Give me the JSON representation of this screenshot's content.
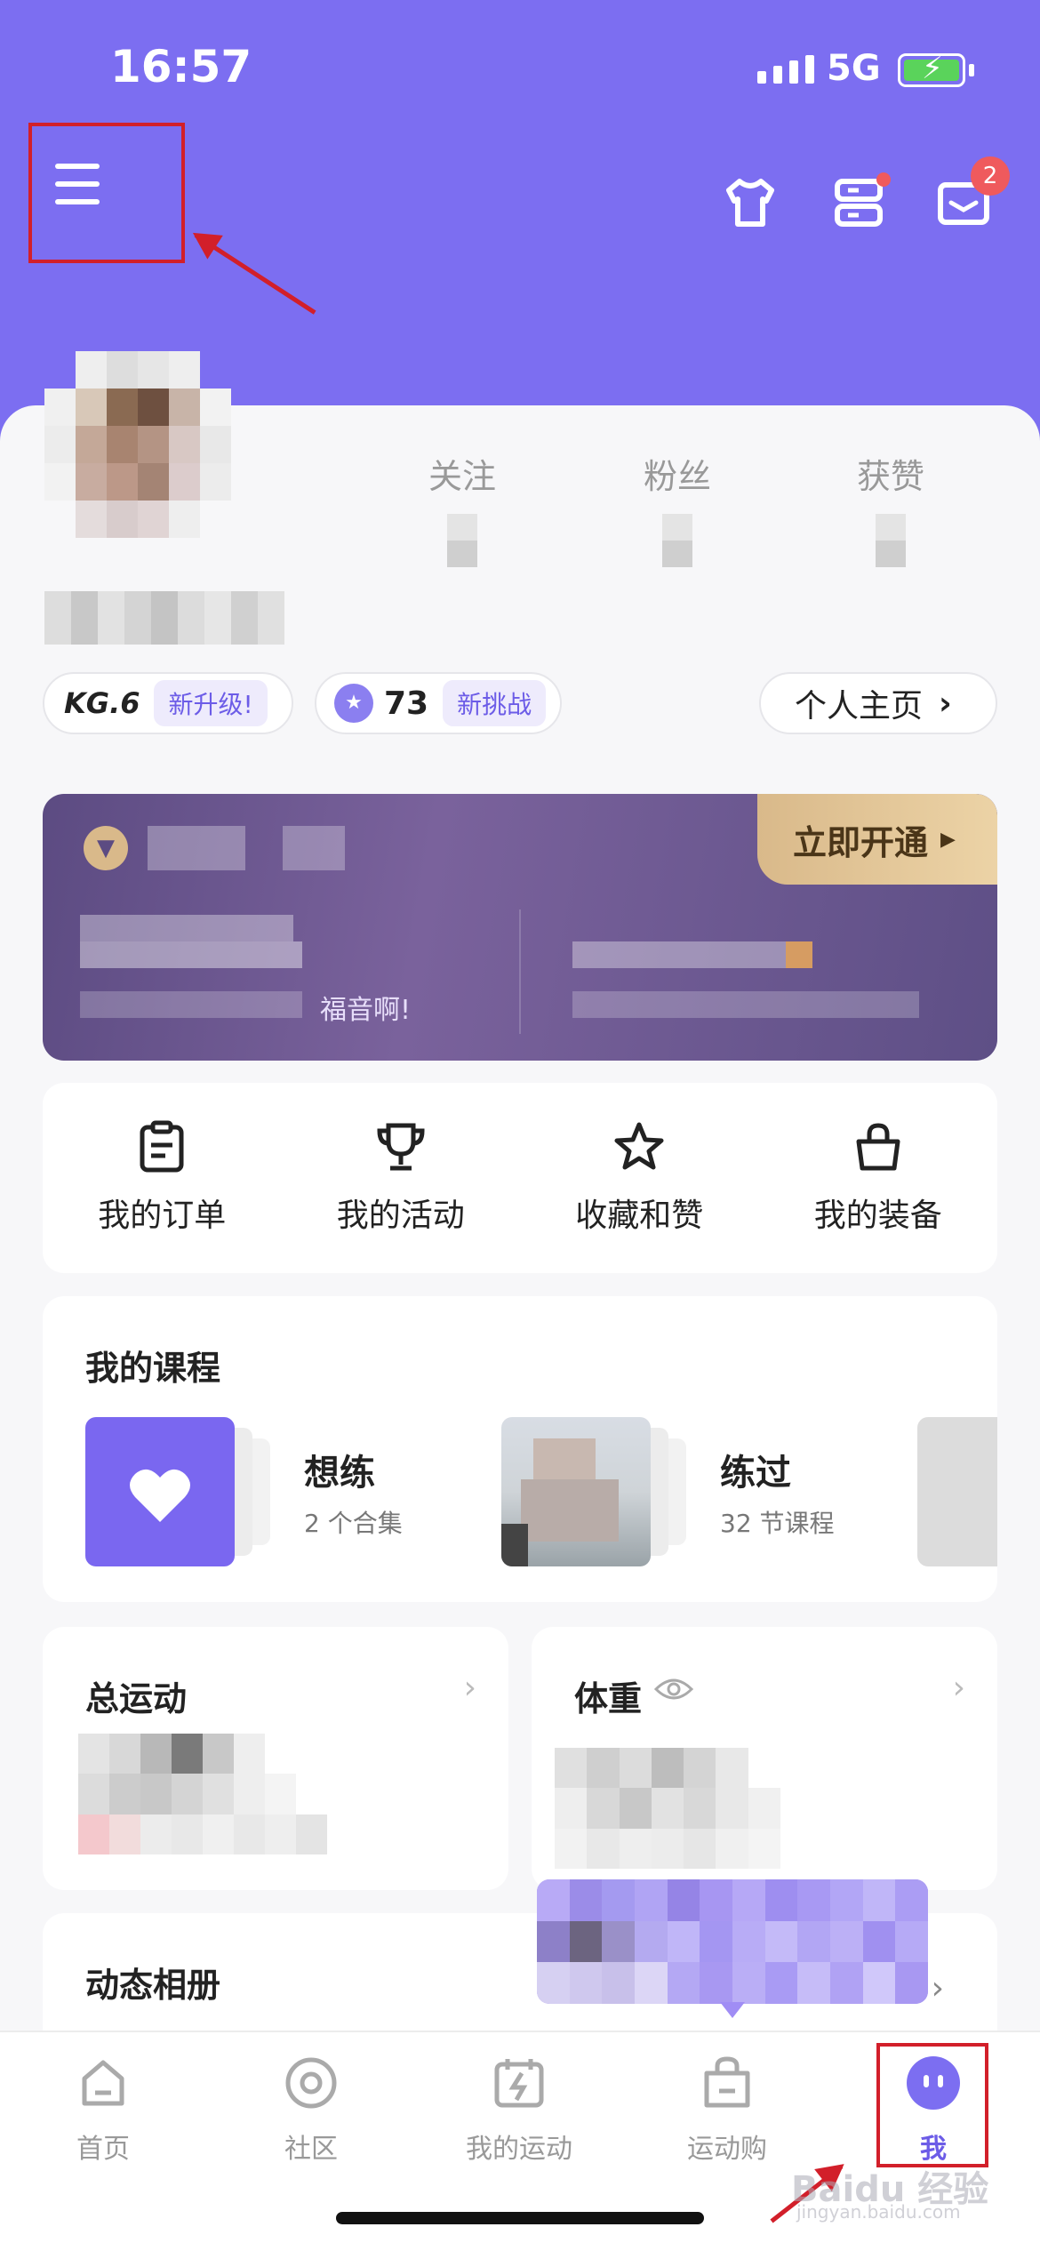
{
  "status_bar": {
    "time": "16:57",
    "network": "5G"
  },
  "header": {
    "notification_count": "2"
  },
  "profile": {
    "stats": [
      {
        "label": "关注"
      },
      {
        "label": "粉丝"
      },
      {
        "label": "获赞"
      }
    ],
    "level_label": "KG.6",
    "level_tag": "新升级!",
    "challenge_count": "73",
    "challenge_tag": "新挑战",
    "home_link": "个人主页"
  },
  "vip_banner": {
    "cta": "立即开通",
    "partial_text": "福音啊!"
  },
  "quick_actions": [
    {
      "label": "我的订单",
      "icon": "clipboard-icon"
    },
    {
      "label": "我的活动",
      "icon": "trophy-icon"
    },
    {
      "label": "收藏和赞",
      "icon": "star-icon"
    },
    {
      "label": "我的装备",
      "icon": "bag-icon"
    }
  ],
  "courses": {
    "title": "我的课程",
    "items": [
      {
        "title": "想练",
        "subtitle": "2 个合集"
      },
      {
        "title": "练过",
        "subtitle": "32 节课程"
      }
    ]
  },
  "stat_cards": {
    "total": {
      "title": "总运动"
    },
    "weight": {
      "title": "体重"
    }
  },
  "album": {
    "title": "动态相册"
  },
  "tab_bar": {
    "items": [
      {
        "label": "首页"
      },
      {
        "label": "社区"
      },
      {
        "label": "我的运动"
      },
      {
        "label": "运动购"
      },
      {
        "label": "我"
      }
    ],
    "active_index": 4
  },
  "watermark": {
    "main": "Baidu 经验",
    "sub": "jingyan.baidu.com"
  },
  "colors": {
    "brand": "#7c6ef1",
    "annotation": "#d21f2a",
    "badge": "#ef5a5d"
  }
}
